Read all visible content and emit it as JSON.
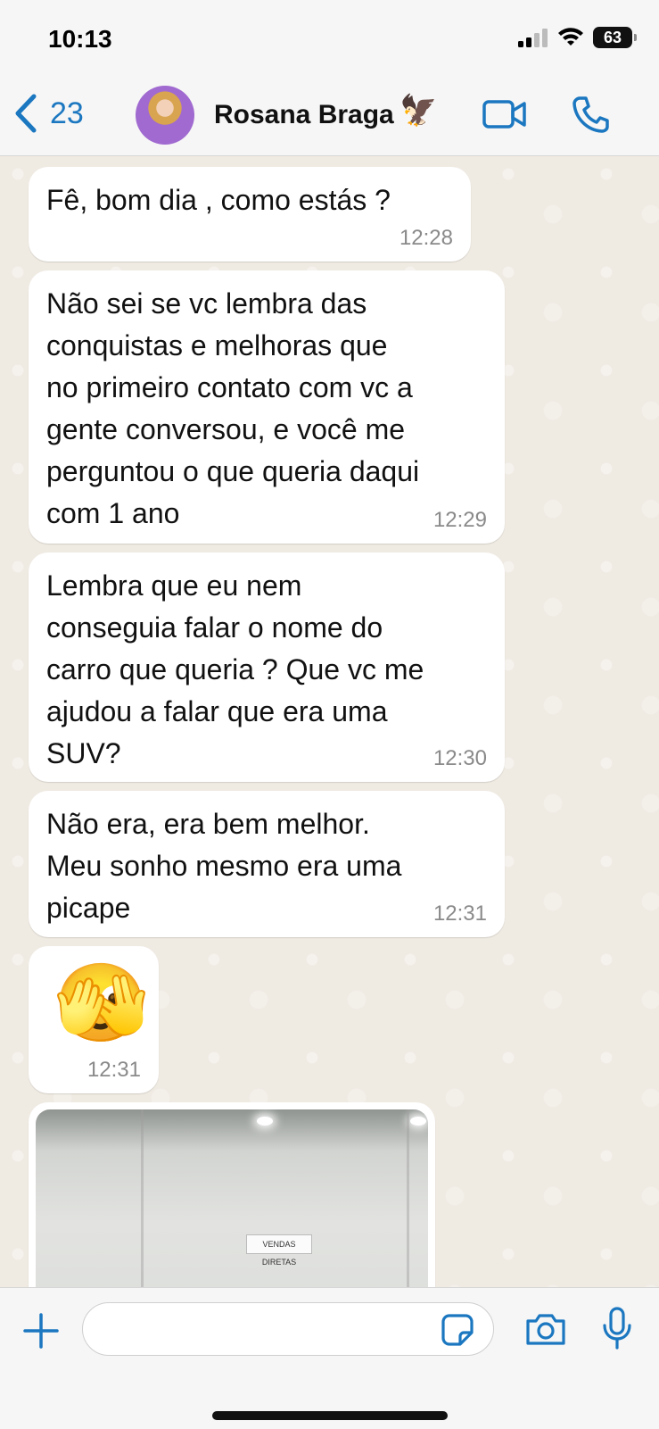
{
  "status_bar": {
    "time": "10:13",
    "battery": "63"
  },
  "header": {
    "back_count": "23",
    "contact_name": "Rosana Braga",
    "name_emoji": "🦅"
  },
  "messages": [
    {
      "text": "Fê, bom dia , como estás ?",
      "time": "12:28"
    },
    {
      "text": "Não sei se vc lembra das\nconquistas e melhoras que\nno primeiro contato com vc a\ngente conversou, e você me\nperguntou o que queria daqui\ncom 1 ano",
      "time": "12:29"
    },
    {
      "text": "Lembra que eu nem\nconseguia falar o nome do\ncarro que queria ? Que vc me\najudou a falar que era uma\nSUV?",
      "time": "12:30"
    },
    {
      "text": "Não era, era bem melhor.\nMeu sonho mesmo era uma\npicape",
      "time": "12:31"
    },
    {
      "emoji": "🫣",
      "time": "12:31"
    }
  ],
  "photo": {
    "sign_text": "VENDAS DIRETAS"
  },
  "composer": {
    "placeholder": ""
  },
  "colors": {
    "accent": "#1b77c0",
    "chat_background": "#efeae2",
    "bubble": "#ffffff",
    "timestamp": "#8a8a8a"
  }
}
